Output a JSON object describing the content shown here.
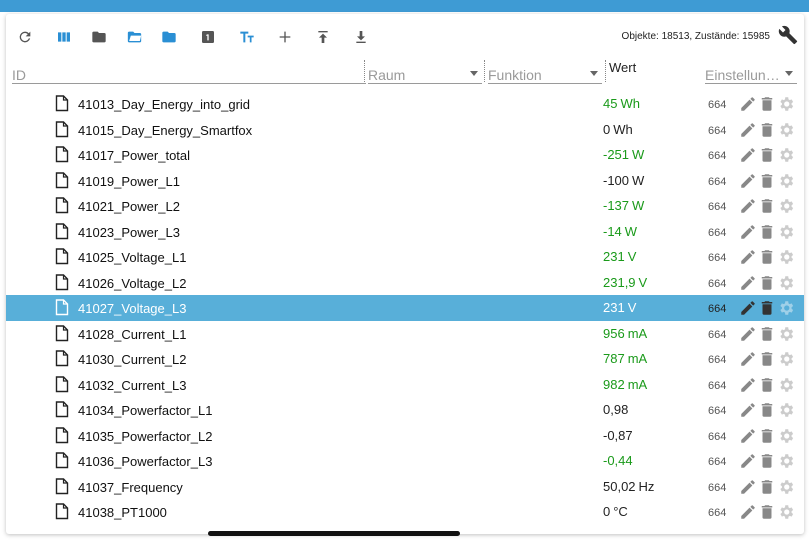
{
  "toolbar": {
    "buttons": [
      {
        "icon": "refresh-icon",
        "color": "#555555"
      },
      {
        "icon": "columns-icon",
        "color": "#2a8fd4"
      },
      {
        "icon": "folder-closed-icon",
        "color": "#555555"
      },
      {
        "icon": "folder-open-icon",
        "color": "#2a8fd4"
      },
      {
        "icon": "folder-icon",
        "color": "#2a8fd4"
      },
      {
        "icon": "one-box-icon",
        "color": "#555555"
      },
      {
        "icon": "text-size-icon",
        "color": "#2a8fd4"
      },
      {
        "icon": "plus-icon",
        "color": "#555555"
      },
      {
        "icon": "upload-icon",
        "color": "#555555"
      },
      {
        "icon": "download-icon",
        "color": "#555555"
      }
    ],
    "stats": "Objekte: 18513, Zustände: 15985"
  },
  "filters": {
    "id_placeholder": "ID",
    "room_placeholder": "Raum",
    "function_placeholder": "Funktion",
    "value_header": "Wert",
    "settings_placeholder": "Einstellun…"
  },
  "colors": {
    "accent": "#58afd9",
    "value_green": "#1a9a1a",
    "topbar": "#3e9bd4"
  },
  "rows": [
    {
      "name": "41013_Day_Energy_into_grid",
      "value": "45",
      "unit": "Wh",
      "color": "green",
      "perm": "664"
    },
    {
      "name": "41015_Day_Energy_Smartfox",
      "value": "0",
      "unit": "Wh",
      "color": "black",
      "perm": "664"
    },
    {
      "name": "41017_Power_total",
      "value": "-251",
      "unit": "W",
      "color": "green",
      "perm": "664"
    },
    {
      "name": "41019_Power_L1",
      "value": "-100",
      "unit": "W",
      "color": "black",
      "perm": "664"
    },
    {
      "name": "41021_Power_L2",
      "value": "-137",
      "unit": "W",
      "color": "green",
      "perm": "664"
    },
    {
      "name": "41023_Power_L3",
      "value": "-14",
      "unit": "W",
      "color": "green",
      "perm": "664"
    },
    {
      "name": "41025_Voltage_L1",
      "value": "231",
      "unit": "V",
      "color": "green",
      "perm": "664"
    },
    {
      "name": "41026_Voltage_L2",
      "value": "231,9",
      "unit": "V",
      "color": "green",
      "perm": "664"
    },
    {
      "name": "41027_Voltage_L3",
      "value": "231",
      "unit": "V",
      "color": "green",
      "perm": "664",
      "selected": true
    },
    {
      "name": "41028_Current_L1",
      "value": "956",
      "unit": "mA",
      "color": "green",
      "perm": "664"
    },
    {
      "name": "41030_Current_L2",
      "value": "787",
      "unit": "mA",
      "color": "green",
      "perm": "664"
    },
    {
      "name": "41032_Current_L3",
      "value": "982",
      "unit": "mA",
      "color": "green",
      "perm": "664"
    },
    {
      "name": "41034_Powerfactor_L1",
      "value": "0,98",
      "unit": "",
      "color": "black",
      "perm": "664"
    },
    {
      "name": "41035_Powerfactor_L2",
      "value": "-0,87",
      "unit": "",
      "color": "black",
      "perm": "664"
    },
    {
      "name": "41036_Powerfactor_L3",
      "value": "-0,44",
      "unit": "",
      "color": "green",
      "perm": "664"
    },
    {
      "name": "41037_Frequency",
      "value": "50,02",
      "unit": "Hz",
      "color": "black",
      "perm": "664"
    },
    {
      "name": "41038_PT1000",
      "value": "0",
      "unit": "°C",
      "color": "black",
      "perm": "664"
    }
  ]
}
